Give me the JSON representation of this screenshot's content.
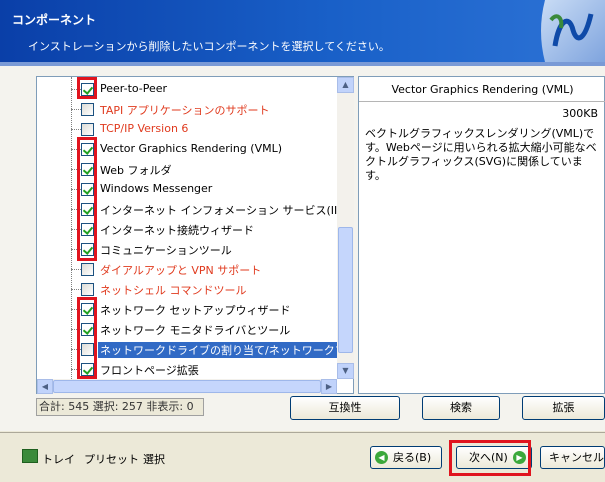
{
  "header": {
    "title": "コンポーネント",
    "subtitle": "インストレーションから削除したいコンポーネントを選択してください。",
    "logo_icon": "logo-swirl-icon"
  },
  "tree": {
    "items": [
      {
        "label": "Peer-to-Peer",
        "checked": true,
        "color": "normal"
      },
      {
        "label": "TAPI アプリケーションのサポート",
        "checked": false,
        "color": "red"
      },
      {
        "label": "TCP/IP Version 6",
        "checked": false,
        "color": "red"
      },
      {
        "label": "Vector Graphics Rendering (VML)",
        "checked": true,
        "color": "normal"
      },
      {
        "label": "Web フォルダ",
        "checked": true,
        "color": "normal"
      },
      {
        "label": "Windows Messenger",
        "checked": true,
        "color": "normal"
      },
      {
        "label": "インターネット インフォメーション サービス(IIS)",
        "checked": true,
        "color": "normal"
      },
      {
        "label": "インターネット接続ウィザード",
        "checked": true,
        "color": "normal"
      },
      {
        "label": "コミュニケーションツール",
        "checked": true,
        "color": "normal"
      },
      {
        "label": "ダイアルアップと VPN サポート",
        "checked": false,
        "color": "red"
      },
      {
        "label": "ネットシェル コマンドツール",
        "checked": false,
        "color": "red"
      },
      {
        "label": "ネットワーク セットアップウィザード",
        "checked": true,
        "color": "normal"
      },
      {
        "label": "ネットワーク モニタドライバとツール",
        "checked": true,
        "color": "normal"
      },
      {
        "label": "ネットワークドライブの割り当て/ネットワークプレース",
        "checked": false,
        "color": "selected"
      },
      {
        "label": "フロントページ拡張",
        "checked": true,
        "color": "normal"
      }
    ]
  },
  "description": {
    "title": "Vector Graphics Rendering (VML)",
    "size": "300KB",
    "body": "ベクトルグラフィックスレンダリング(VML)です。Webページに用いられる拡大縮小可能なベクトルグラフィックス(SVG)に関係しています。"
  },
  "status": {
    "counts": "合計: 545 選択: 257 非表示: 0"
  },
  "panel_buttons": {
    "compat": "互換性",
    "search": "検索",
    "expand": "拡張"
  },
  "footer": {
    "tray": "トレイ",
    "preset": "プリセット",
    "select": "選択",
    "back": "戻る(B)",
    "next": "次へ(N)",
    "cancel": "キャンセル(C)"
  },
  "colors": {
    "header_blue": "#0a3fa8",
    "highlight_red": "#e0141e",
    "selection_blue": "#316ac5",
    "disabled_red_text": "#e03a1e"
  }
}
